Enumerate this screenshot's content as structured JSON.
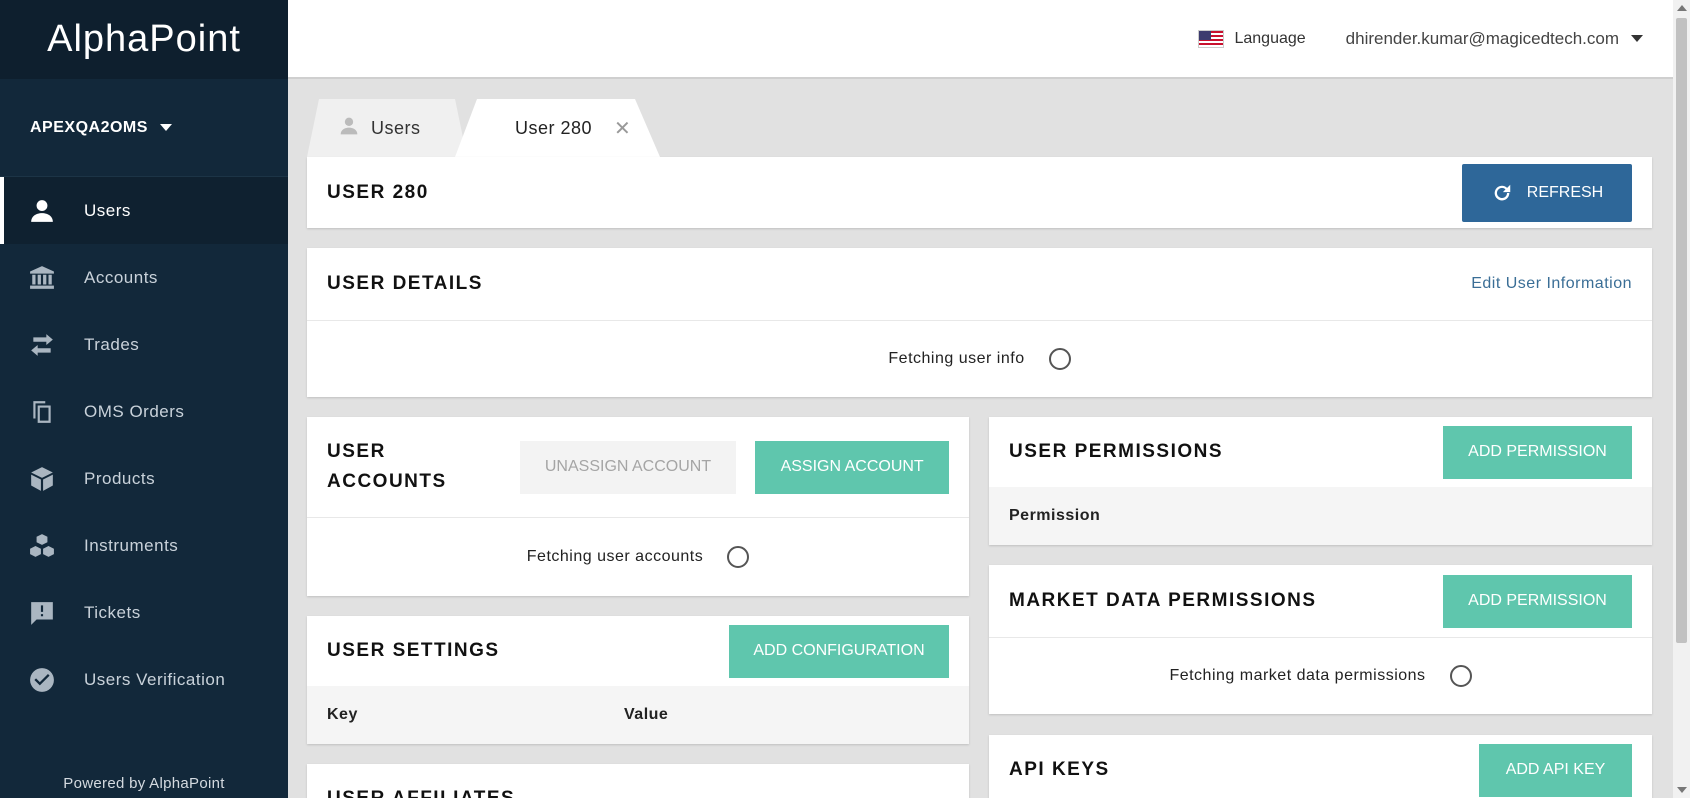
{
  "app": {
    "logo": "AlphaPoint",
    "oms": "APEXQA2OMS",
    "powered_by": "Powered by AlphaPoint"
  },
  "sidebar": {
    "items": [
      {
        "label": "Users",
        "icon": "user-icon",
        "active": true
      },
      {
        "label": "Accounts",
        "icon": "bank-icon"
      },
      {
        "label": "Trades",
        "icon": "swap-arrows-icon"
      },
      {
        "label": "OMS Orders",
        "icon": "copy-icon"
      },
      {
        "label": "Products",
        "icon": "cube-icon"
      },
      {
        "label": "Instruments",
        "icon": "cubes-icon"
      },
      {
        "label": "Tickets",
        "icon": "chat-alert-icon"
      },
      {
        "label": "Users Verification",
        "icon": "check-circle-icon"
      }
    ]
  },
  "topbar": {
    "language": "Language",
    "email": "dhirender.kumar@magicedtech.com"
  },
  "tabs": {
    "users": "Users",
    "user280": "User 280"
  },
  "header": {
    "title": "USER 280",
    "refresh": "REFRESH"
  },
  "user_details": {
    "title": "USER DETAILS",
    "edit": "Edit User Information",
    "fetching": "Fetching user info"
  },
  "user_accounts": {
    "title_line1": "USER",
    "title_line2": "ACCOUNTS",
    "unassign": "UNASSIGN ACCOUNT",
    "assign": "ASSIGN ACCOUNT",
    "fetching": "Fetching user accounts"
  },
  "user_settings": {
    "title": "USER SETTINGS",
    "add": "ADD CONFIGURATION",
    "col_key": "Key",
    "col_value": "Value"
  },
  "user_affiliates": {
    "title": "USER AFFILIATES"
  },
  "user_permissions": {
    "title": "USER PERMISSIONS",
    "add": "ADD PERMISSION",
    "col": "Permission"
  },
  "market_data": {
    "title": "MARKET DATA PERMISSIONS",
    "add": "ADD PERMISSION",
    "fetching": "Fetching market data permissions"
  },
  "api_keys": {
    "title": "API KEYS",
    "add": "ADD API KEY"
  }
}
